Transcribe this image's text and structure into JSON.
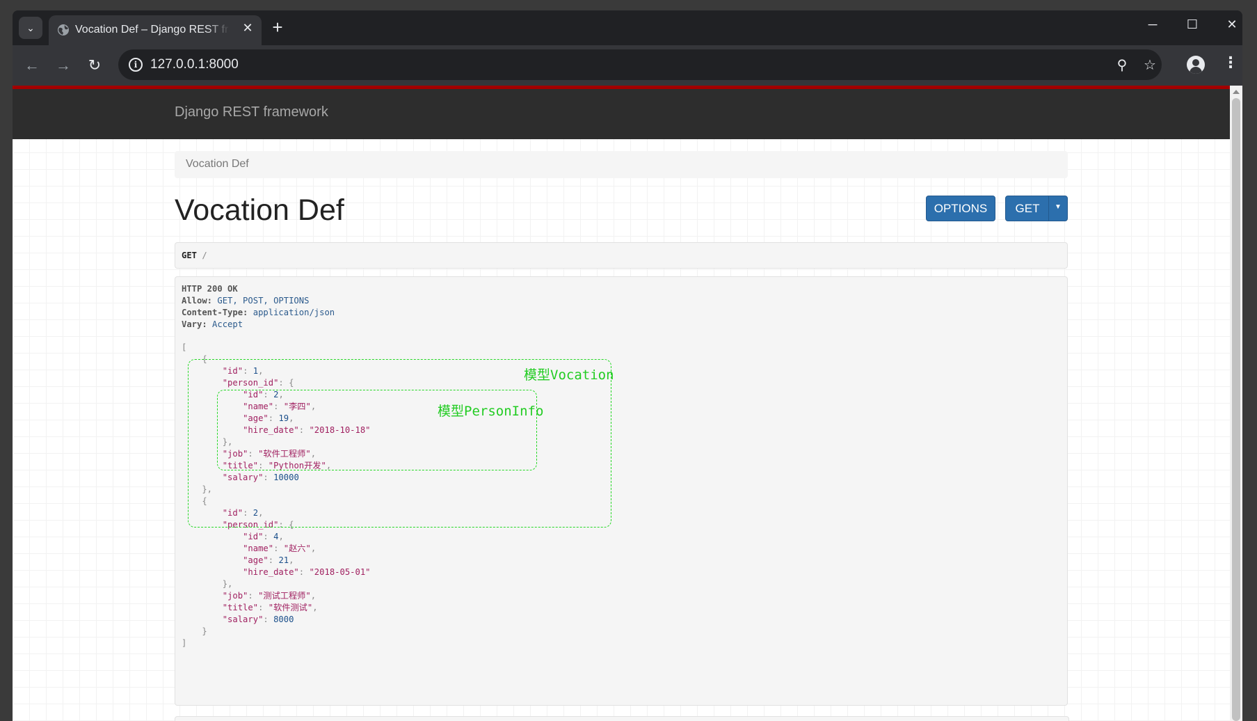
{
  "browser": {
    "tab_title": "Vocation Def – Django REST framework",
    "tab_close": "✕",
    "new_tab": "+",
    "url": "127.0.0.1:8000",
    "tab_search_icon": "⌄",
    "minimize_icon": "─",
    "maximize_icon": "☐",
    "close_icon": "✕",
    "back_icon": "←",
    "forward_icon": "→",
    "reload_icon": "↻",
    "zoom_icon": "⚲",
    "bookmark_icon": "☆",
    "menu_icon": "⋮",
    "info_icon": "i"
  },
  "navbar": {
    "brand": "Django REST framework"
  },
  "breadcrumb": {
    "item": "Vocation Def"
  },
  "page": {
    "title": "Vocation Def",
    "options_button": "OPTIONS",
    "get_button": "GET",
    "get_caret": "▼"
  },
  "request": {
    "method": "GET",
    "path": "/"
  },
  "response": {
    "status": "HTTP 200 OK",
    "headers": [
      {
        "name": "Allow:",
        "value": "GET, POST, OPTIONS"
      },
      {
        "name": "Content-Type:",
        "value": "application/json"
      },
      {
        "name": "Vary:",
        "value": "Accept"
      }
    ],
    "items": [
      {
        "id": "1",
        "person": {
          "id": "2",
          "name": "\"李四\"",
          "age": "19",
          "hire_date": "\"2018-10-18\""
        },
        "job": "\"软件工程师\"",
        "title": "\"Python开发\"",
        "salary": "10000"
      },
      {
        "id": "2",
        "person": {
          "id": "4",
          "name": "\"赵六\"",
          "age": "21",
          "hire_date": "\"2018-05-01\""
        },
        "job": "\"测试工程师\"",
        "title": "\"软件测试\"",
        "salary": "8000"
      }
    ]
  },
  "annotations": {
    "vocation_label": "模型Vocation",
    "personinfo_label": "模型PersonInfo",
    "color": "#22cc22"
  }
}
